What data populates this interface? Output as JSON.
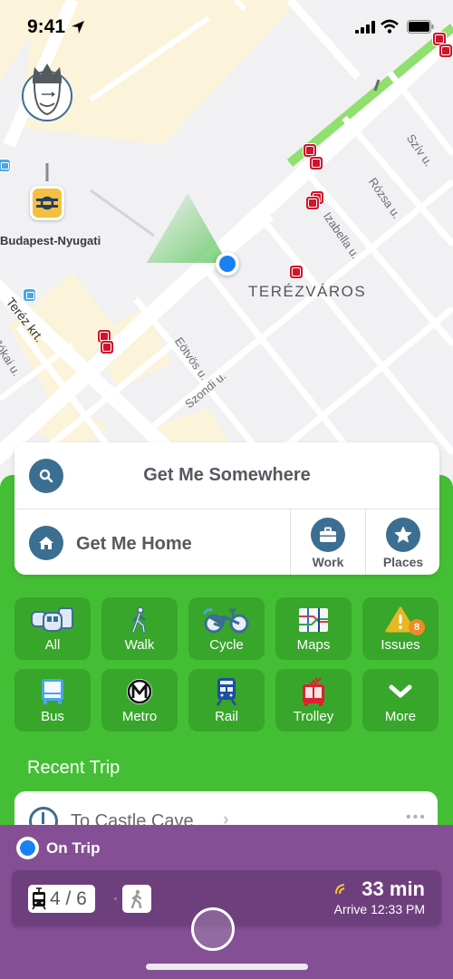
{
  "status_bar": {
    "time": "9:41"
  },
  "map": {
    "district_label": "TERÉZVÁROS",
    "station_label": "Budapest-Nyugati",
    "street_labels": [
      "Teréz krt.",
      "Eötvös u.",
      "Szondi u.",
      "Izabella u.",
      "Rózsa u.",
      "Szív u.",
      "Jókai u."
    ]
  },
  "search": {
    "get_me_somewhere": "Get Me Somewhere",
    "get_me_home": "Get Me Home",
    "work": "Work",
    "places": "Places"
  },
  "modes": [
    {
      "label": "All",
      "icon": "all-transit-icon"
    },
    {
      "label": "Walk",
      "icon": "walk-icon"
    },
    {
      "label": "Cycle",
      "icon": "bicycle-icon"
    },
    {
      "label": "Maps",
      "icon": "transit-map-icon"
    },
    {
      "label": "Issues",
      "icon": "warning-icon",
      "badge": "8"
    },
    {
      "label": "Bus",
      "icon": "bus-icon"
    },
    {
      "label": "Metro",
      "icon": "metro-icon"
    },
    {
      "label": "Rail",
      "icon": "rail-icon"
    },
    {
      "label": "Trolley",
      "icon": "trolley-icon"
    },
    {
      "label": "More",
      "icon": "chevron-down-icon"
    }
  ],
  "recent": {
    "title": "Recent Trip",
    "destination": "To Castle Cave",
    "chevron": "›",
    "more": "•••"
  },
  "trip": {
    "status": "On Trip",
    "leg_progress": "4 / 6",
    "eta": "33 min",
    "arrive": "Arrive 12:33 PM"
  },
  "colors": {
    "panel_green": "#44bf35",
    "tile_green": "#38a62b",
    "trip_purple": "#854f96",
    "icon_blue": "#3c6e91",
    "location_blue": "#1a82f0",
    "tram_red": "#d0142b",
    "badge_orange": "#f08a24"
  }
}
